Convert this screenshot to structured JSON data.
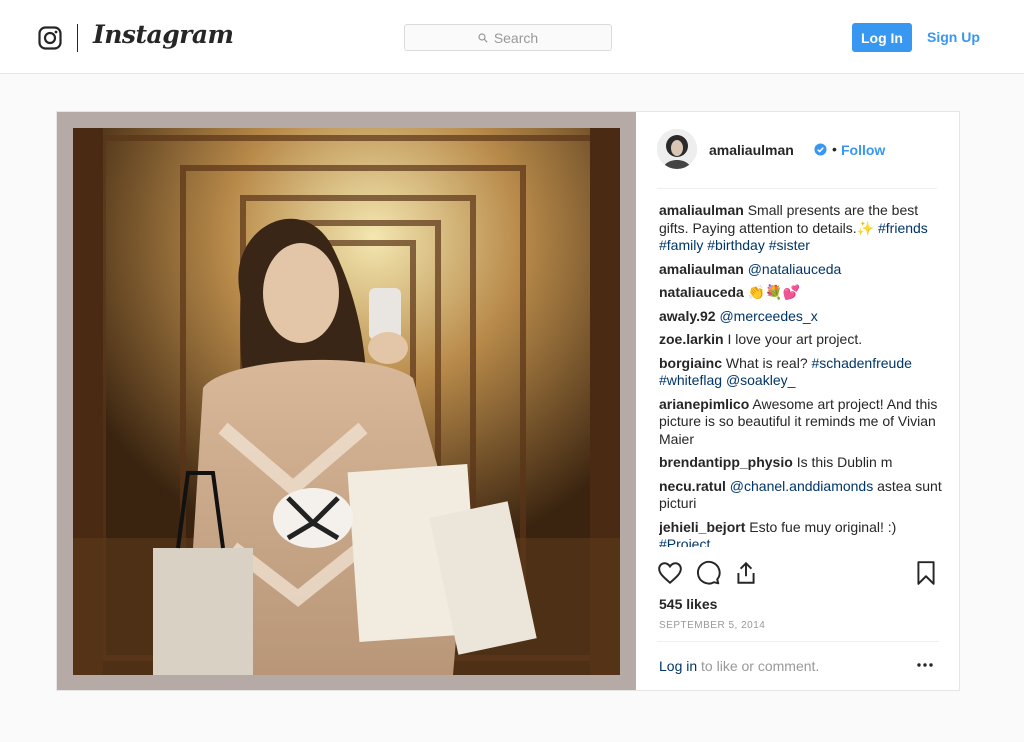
{
  "header": {
    "wordmark": "Instagram",
    "search_placeholder": "Search",
    "login_label": "Log In",
    "signup_label": "Sign Up"
  },
  "post": {
    "username": "amaliaulman",
    "separator": "•",
    "follow_label": "Follow",
    "comments": [
      {
        "user": "amaliaulman",
        "parts": [
          {
            "t": "text",
            "v": "Small presents are the best gifts. Paying attention to details.✨ "
          },
          {
            "t": "tag",
            "v": "#friends"
          },
          {
            "t": "text",
            "v": " "
          },
          {
            "t": "tag",
            "v": "#family"
          },
          {
            "t": "text",
            "v": " "
          },
          {
            "t": "tag",
            "v": "#birthday"
          },
          {
            "t": "text",
            "v": " "
          },
          {
            "t": "tag",
            "v": "#sister"
          }
        ]
      },
      {
        "user": "amaliaulman",
        "parts": [
          {
            "t": "tag",
            "v": "@nataliauceda"
          }
        ]
      },
      {
        "user": "nataliauceda",
        "parts": [
          {
            "t": "text",
            "v": "👏💐💕"
          }
        ]
      },
      {
        "user": "awaly.92",
        "parts": [
          {
            "t": "tag",
            "v": "@merceedes_x"
          }
        ]
      },
      {
        "user": "zoe.larkin",
        "parts": [
          {
            "t": "text",
            "v": "I love your art project."
          }
        ]
      },
      {
        "user": "borgiainc",
        "parts": [
          {
            "t": "text",
            "v": "What is real? "
          },
          {
            "t": "tag",
            "v": "#schadenfreude"
          },
          {
            "t": "text",
            "v": " "
          },
          {
            "t": "tag",
            "v": "#whiteflag"
          },
          {
            "t": "text",
            "v": " "
          },
          {
            "t": "tag",
            "v": "@soakley_"
          }
        ]
      },
      {
        "user": "arianepimlico",
        "parts": [
          {
            "t": "text",
            "v": "Awesome art project! And this picture is so beautiful it reminds me of Vivian Maier"
          }
        ]
      },
      {
        "user": "brendantipp_physio",
        "parts": [
          {
            "t": "text",
            "v": "Is this Dublin m"
          }
        ]
      },
      {
        "user": "necu.ratul",
        "parts": [
          {
            "t": "tag",
            "v": "@chanel.anddiamonds"
          },
          {
            "t": "text",
            "v": " astea sunt picturi"
          }
        ]
      },
      {
        "user": "jehieli_bejort",
        "parts": [
          {
            "t": "text",
            "v": "Esto fue muy original! :) "
          },
          {
            "t": "tag",
            "v": "#Project"
          }
        ]
      }
    ],
    "likes": "545 likes",
    "date": "SEPTEMBER 5, 2014",
    "login_link": "Log in",
    "login_suffix": " to like or comment.",
    "icons": [
      "instagram-camera-icon",
      "search-icon",
      "verified-icon",
      "heart-icon",
      "comment-icon",
      "share-icon",
      "bookmark-icon",
      "more-icon"
    ]
  },
  "colors": {
    "accent": "#3897f0",
    "link_dark": "#003569",
    "muted": "#999999",
    "photo_frame": "#b6aaa6"
  }
}
